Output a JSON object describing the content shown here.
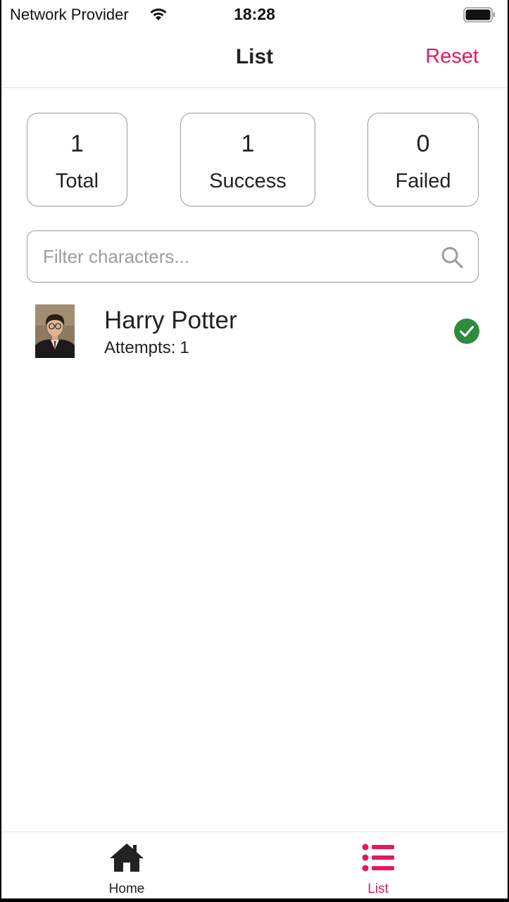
{
  "status_bar": {
    "carrier": "Network Provider",
    "time": "18:28",
    "wifi_icon": "wifi-icon",
    "battery_icon": "battery-icon"
  },
  "nav": {
    "title": "List",
    "reset_label": "Reset",
    "accent_color": "#e3195a"
  },
  "stats": [
    {
      "value": "1",
      "label": "Total"
    },
    {
      "value": "1",
      "label": "Success"
    },
    {
      "value": "0",
      "label": "Failed"
    }
  ],
  "search": {
    "placeholder": "Filter characters...",
    "value": "",
    "icon": "search-icon"
  },
  "characters": [
    {
      "name": "Harry Potter",
      "attempts_label": "Attempts:",
      "attempts": "1",
      "status": "success",
      "status_icon": "check-circle-icon",
      "status_color": "#2e8b3e"
    }
  ],
  "tabs": [
    {
      "label": "Home",
      "icon": "home-icon",
      "active": false
    },
    {
      "label": "List",
      "icon": "list-icon",
      "active": true
    }
  ]
}
